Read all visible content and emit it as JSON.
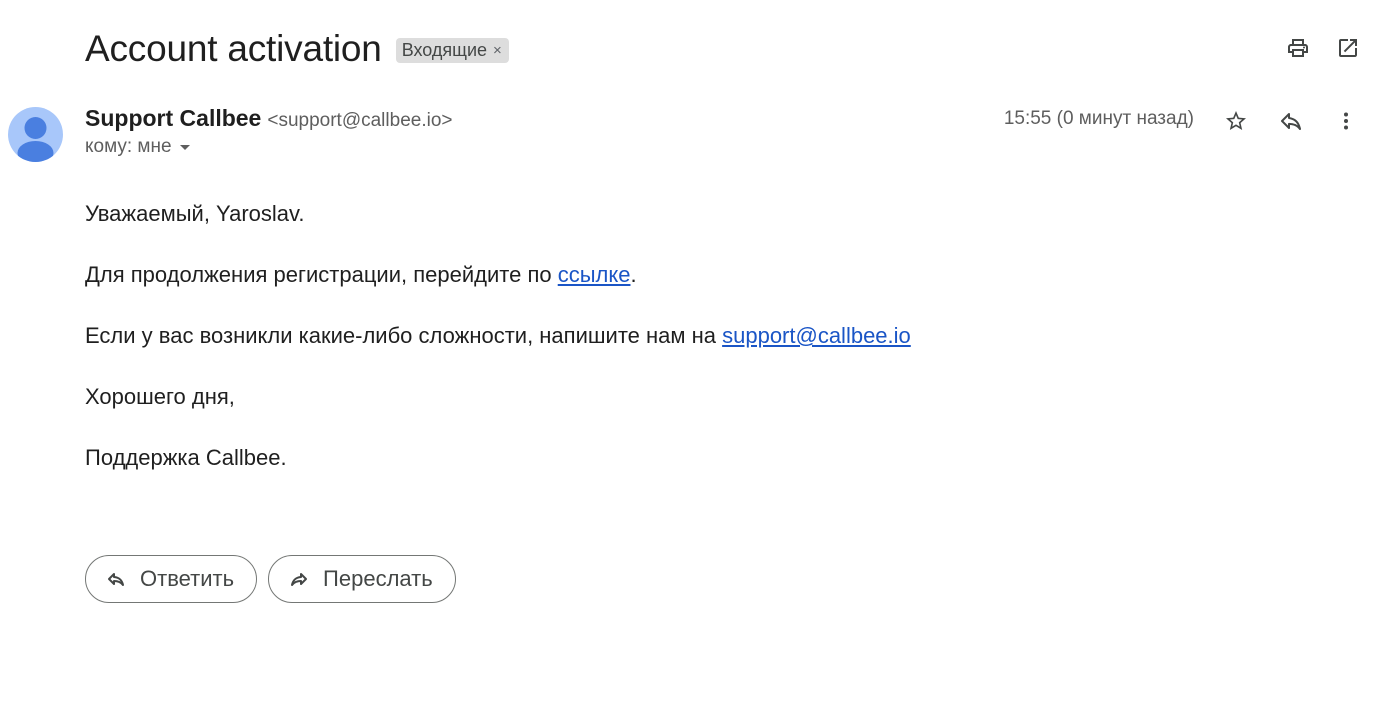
{
  "email": {
    "subject": "Account activation",
    "label": "Входящие",
    "label_remove": "×",
    "sender_name": "Support Callbee",
    "sender_email": "<support@callbee.io>",
    "to_line": "кому: мне",
    "time": "15:55 (0 минут назад)"
  },
  "body": {
    "greeting": "Уважаемый, Yaroslav.",
    "line1_prefix": "Для продолжения регистрации, перейдите по ",
    "line1_link": "ссылке",
    "line1_suffix": ".",
    "line2_prefix": "Если у вас возникли какие-либо сложности, напишите нам на ",
    "line2_link": "support@callbee.io",
    "closing": "Хорошего дня,",
    "signature": "Поддержка Callbee."
  },
  "actions": {
    "reply": "Ответить",
    "forward": "Переслать"
  },
  "icons": {
    "print": "print-icon",
    "open_new_window": "open-in-new-icon",
    "star": "star-icon",
    "reply": "reply-icon",
    "more": "more-vert-icon",
    "forward": "forward-icon",
    "avatar": "person-avatar"
  },
  "colors": {
    "link": "#1a55c6",
    "avatar_bg": "#a8c7fa",
    "avatar_fg": "#4a7fe0",
    "chip_bg": "#dddddd"
  }
}
